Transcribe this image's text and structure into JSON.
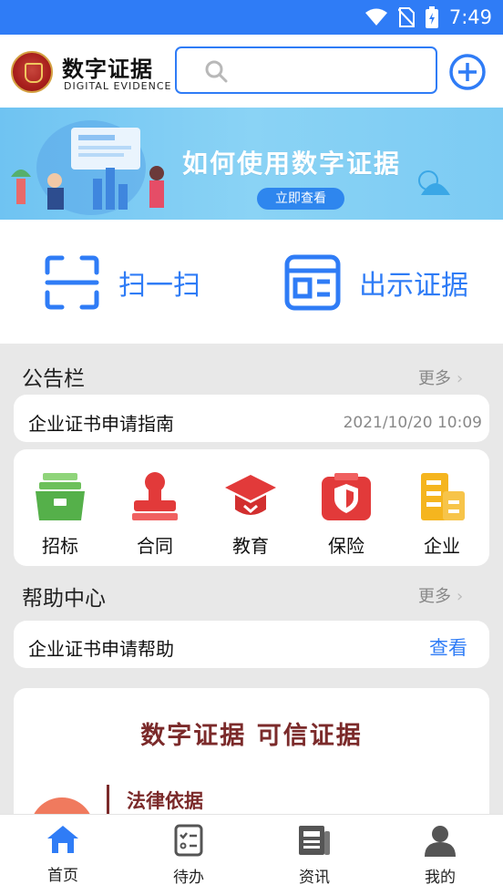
{
  "status": {
    "time": "7:49"
  },
  "header": {
    "app_title": "数字证据",
    "app_subtitle": "DIGITAL EVIDENCE",
    "search_placeholder": ""
  },
  "banner": {
    "title": "如何使用数字证据",
    "button_label": "立即查看"
  },
  "quick_actions": [
    {
      "label": "扫一扫",
      "icon": "scan-icon"
    },
    {
      "label": "出示证据",
      "icon": "evidence-card-icon"
    }
  ],
  "notice": {
    "title": "公告栏",
    "more_label": "更多",
    "item_title": "企业证书申请指南",
    "item_time": "2021/10/20 10:09"
  },
  "categories": [
    {
      "label": "招标",
      "icon": "bid-box-icon",
      "color": "#5cb85c"
    },
    {
      "label": "合同",
      "icon": "stamp-icon",
      "color": "#e23a3a"
    },
    {
      "label": "教育",
      "icon": "graduation-cap-icon",
      "color": "#e23a3a"
    },
    {
      "label": "保险",
      "icon": "shield-icon",
      "color": "#e23a3a"
    },
    {
      "label": "企业",
      "icon": "building-icon",
      "color": "#f5b51f"
    }
  ],
  "help": {
    "title": "帮助中心",
    "more_label": "更多",
    "item_title": "企业证书申请帮助",
    "view_label": "查看"
  },
  "promo": {
    "title": "数字证据    可信证据",
    "subtitle": "法律依据"
  },
  "tabbar": [
    {
      "label": "首页",
      "icon": "home-icon",
      "active": true
    },
    {
      "label": "待办",
      "icon": "todo-icon",
      "active": false
    },
    {
      "label": "资讯",
      "icon": "news-icon",
      "active": false
    },
    {
      "label": "我的",
      "icon": "user-icon",
      "active": false
    }
  ],
  "colors": {
    "primary": "#2f7cf6",
    "status_bar": "#2f7cf6",
    "promo_text": "#7b2a2a"
  }
}
